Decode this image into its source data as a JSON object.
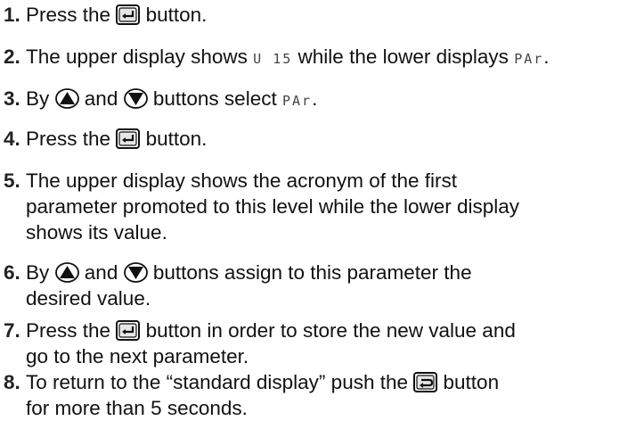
{
  "steps": [
    {
      "num": "1.",
      "a": "Press the",
      "b": "button."
    },
    {
      "num": "2.",
      "a": "The upper display shows",
      "seg1": "U 15",
      "b": "while the lower displays",
      "seg2": "PAr",
      "c": "."
    },
    {
      "num": "3.",
      "a": "By",
      "b": "and",
      "c": "buttons select",
      "seg": "PAr",
      "d": "."
    },
    {
      "num": "4.",
      "a": "Press the",
      "b": "button."
    },
    {
      "num": "5.",
      "lines": [
        "The upper display shows the acronym of the first",
        "parameter promoted to this level while the lower display",
        "shows its value."
      ]
    },
    {
      "num": "6.",
      "a": "By",
      "b": "and",
      "c": "buttons assign to this parameter the",
      "line2": "desired value."
    },
    {
      "num": "7.",
      "a": "Press the",
      "b": "button in order to store the new value and",
      "line2": "go to the next parameter."
    },
    {
      "num": "8.",
      "a": "To return to the “standard display” push the",
      "b": "button",
      "line2": "for more than 5 seconds."
    }
  ],
  "icons": {
    "enter": "enter-key-icon",
    "up": "up-arrow-icon",
    "down": "down-arrow-icon",
    "loop": "loop-return-icon"
  },
  "colors": {
    "text": "#111111",
    "segment": "#444444"
  }
}
